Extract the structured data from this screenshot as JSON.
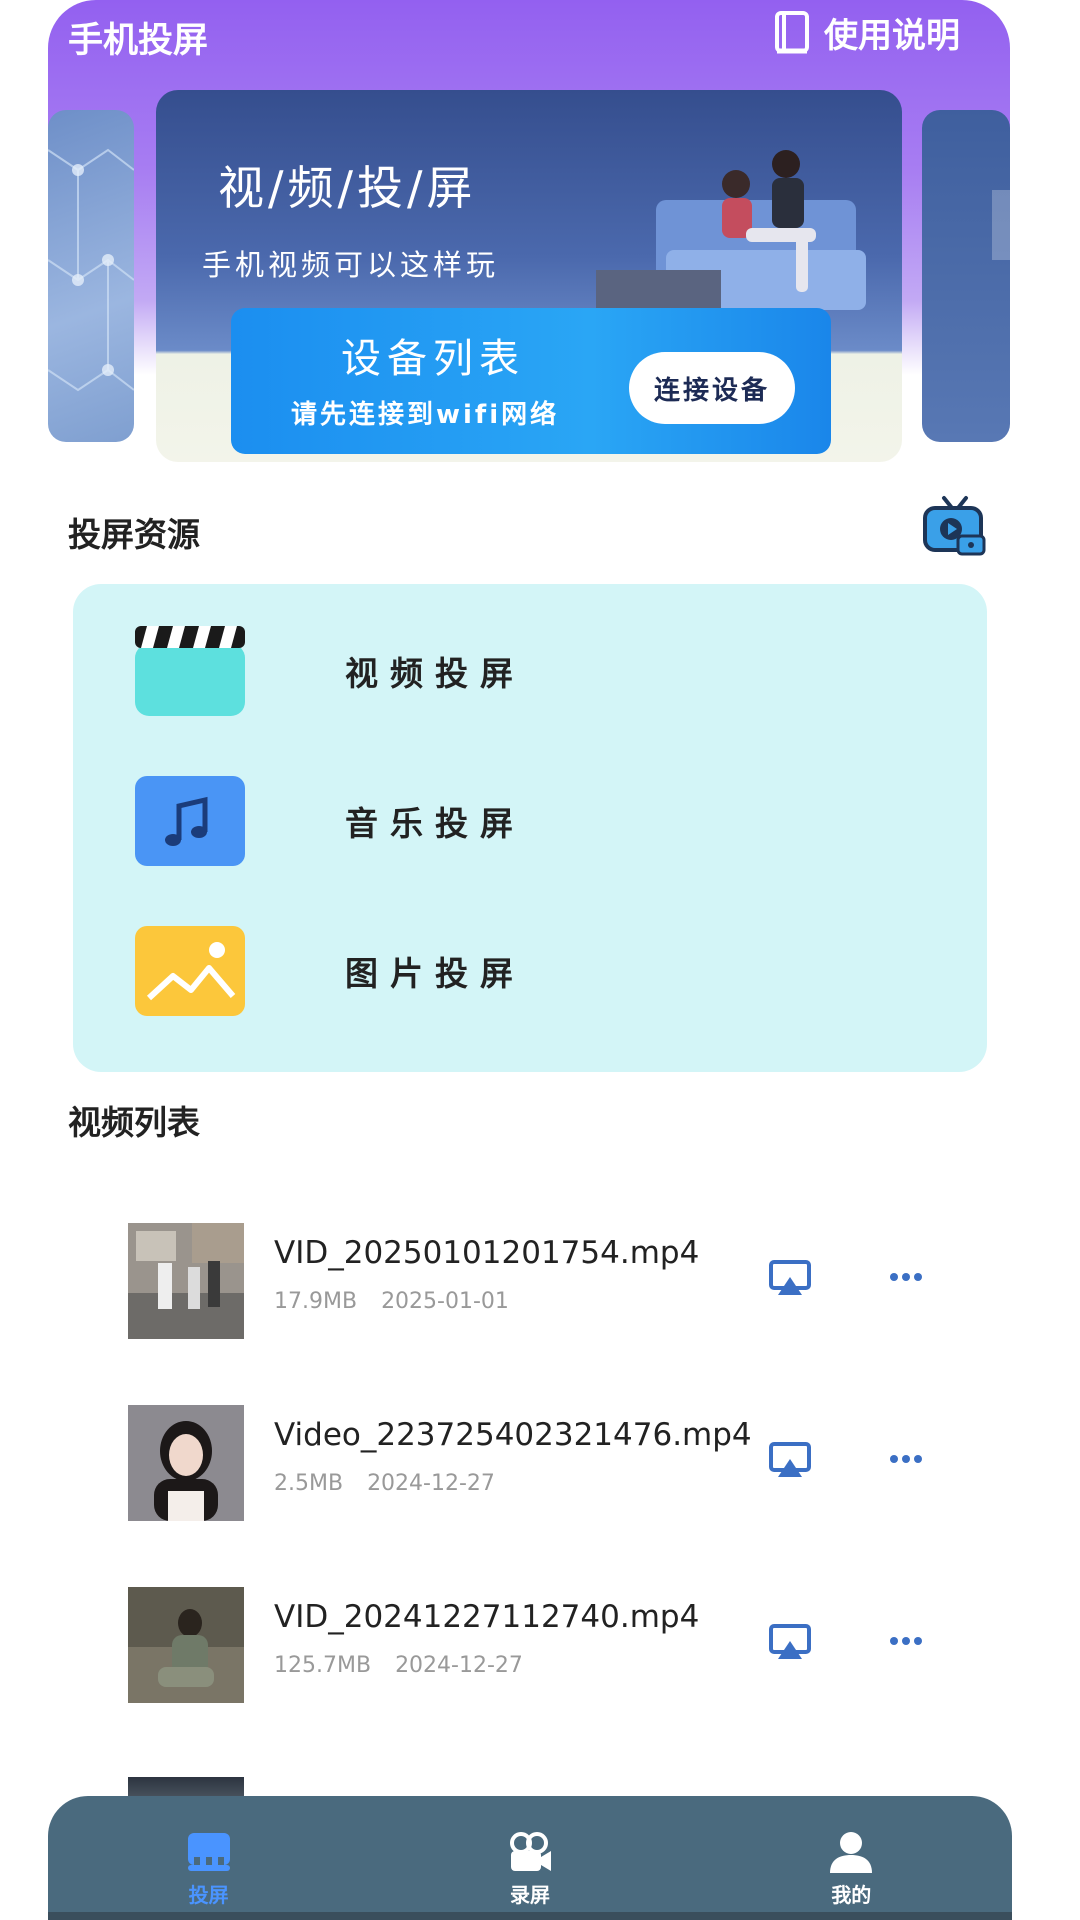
{
  "header": {
    "app_title": "手机投屏",
    "manual_label": "使用说明",
    "manual_icon": "book-icon"
  },
  "banner": {
    "title": "视/频/投/屏",
    "subtitle": "手机视频可以这样玩",
    "device_panel": {
      "title": "设备列表",
      "subtitle": "请先连接到wifi网络",
      "button_label": "连接设备"
    }
  },
  "resources": {
    "title": "投屏资源",
    "tv_icon": "tv-play-icon",
    "items": [
      {
        "label": "视频投屏",
        "icon": "clapperboard-icon",
        "color": "#5de0de"
      },
      {
        "label": "音乐投屏",
        "icon": "music-note-icon",
        "color": "#4a95f5"
      },
      {
        "label": "图片投屏",
        "icon": "image-icon",
        "color": "#fcc73b"
      }
    ]
  },
  "video_list": {
    "title": "视频列表",
    "items": [
      {
        "name": "VID_20250101201754.mp4",
        "size": "17.9MB",
        "date": "2025-01-01"
      },
      {
        "name": "Video_223725402321476.mp4",
        "size": "2.5MB",
        "date": "2024-12-27"
      },
      {
        "name": "VID_20241227112740.mp4",
        "size": "125.7MB",
        "date": "2024-12-27"
      }
    ]
  },
  "bottom_nav": {
    "items": [
      {
        "label": "投屏",
        "icon": "cast-screen-icon",
        "active": true
      },
      {
        "label": "录屏",
        "icon": "video-camera-icon",
        "active": false
      },
      {
        "label": "我的",
        "icon": "user-icon",
        "active": false
      }
    ]
  },
  "colors": {
    "header_gradient_top": "#9360f0",
    "resource_card_bg": "#d3f5f7",
    "nav_bg": "#4a6a7e",
    "nav_active": "#4a94ff",
    "action_icon": "#3b6fc4"
  }
}
